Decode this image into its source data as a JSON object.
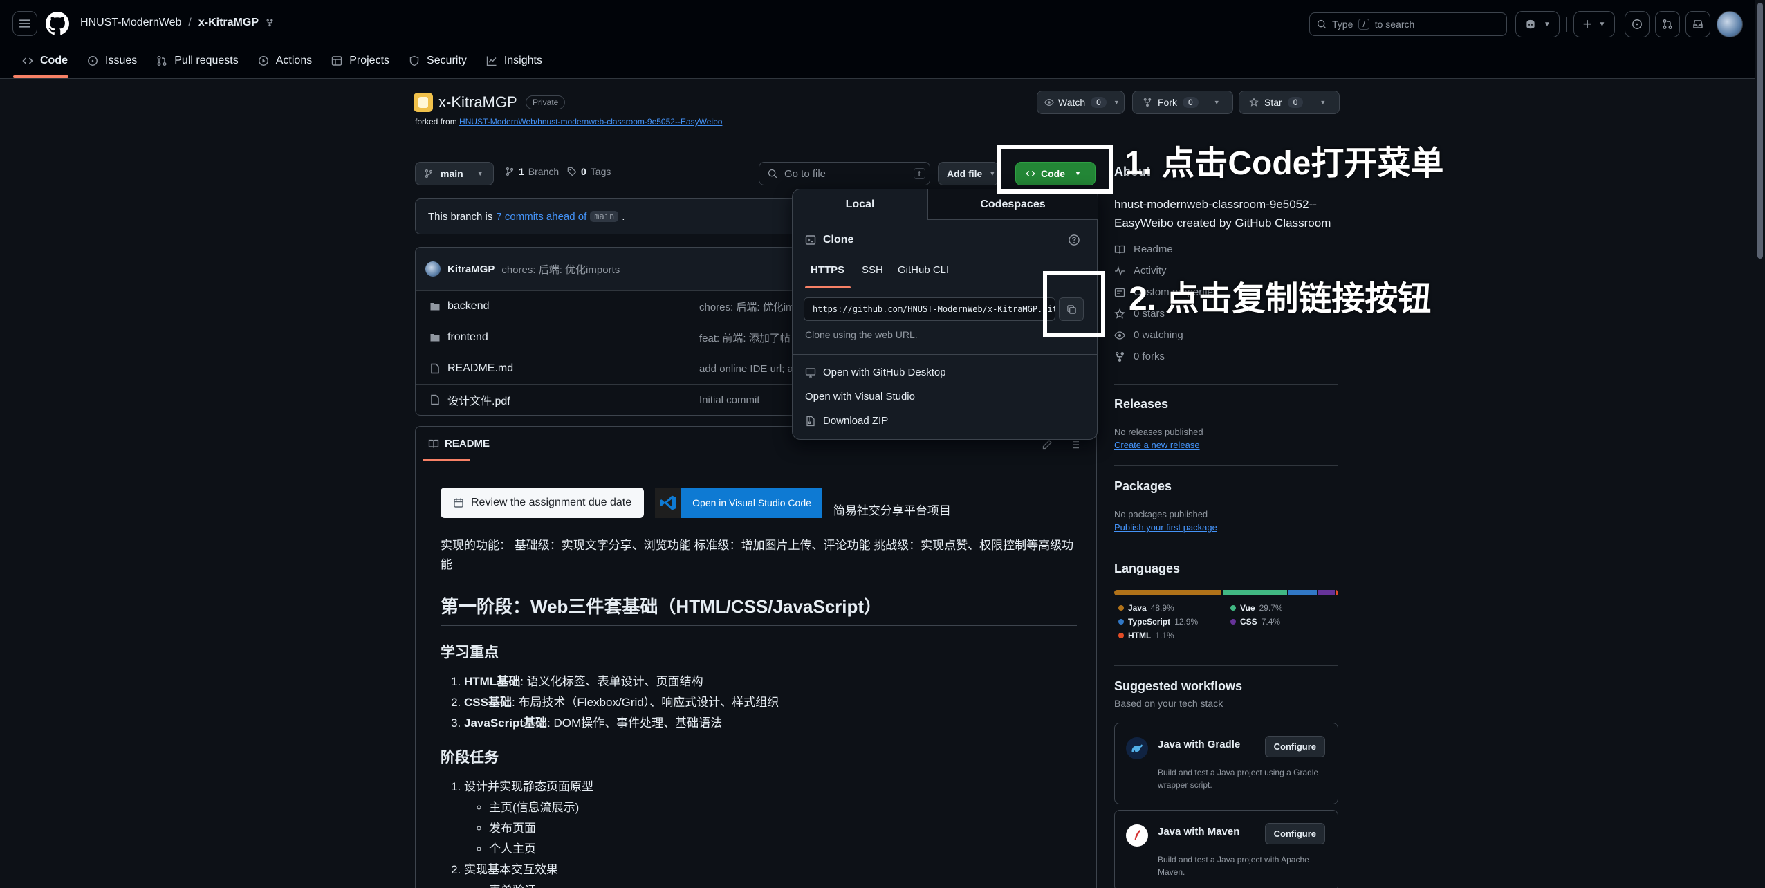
{
  "header": {
    "owner": "HNUST-ModernWeb",
    "separator": "/",
    "repo": "x-KitraMGP",
    "search_prefix": "Type",
    "search_key": "/",
    "search_suffix": "to search"
  },
  "tabs": [
    {
      "label": "Code",
      "icon": "code-icon"
    },
    {
      "label": "Issues",
      "icon": "issue-icon"
    },
    {
      "label": "Pull requests",
      "icon": "pull-request-icon"
    },
    {
      "label": "Actions",
      "icon": "play-icon"
    },
    {
      "label": "Projects",
      "icon": "table-icon"
    },
    {
      "label": "Security",
      "icon": "shield-icon"
    },
    {
      "label": "Insights",
      "icon": "graph-icon"
    }
  ],
  "repo": {
    "name": "x-KitraMGP",
    "visibility": "Private",
    "forked_prefix": "forked from",
    "forked_from": "HNUST-ModernWeb/hnust-modernweb-classroom-9e5052--EasyWeibo",
    "watch_label": "Watch",
    "watch_count": "0",
    "fork_label": "Fork",
    "fork_count": "0",
    "star_label": "Star",
    "star_count": "0"
  },
  "toolbar": {
    "branch": "main",
    "branch_count": "1",
    "branch_label": "Branch",
    "tag_count": "0",
    "tag_label": "Tags",
    "goto_placeholder": "Go to file",
    "goto_key": "t",
    "add_file": "Add file",
    "code": "Code"
  },
  "ahead": {
    "prefix": "This branch is",
    "link": "7 commits ahead of",
    "branch": "main",
    "suffix": "."
  },
  "commit": {
    "author": "KitraMGP",
    "message": "chores: 后端: 优化imports"
  },
  "files": [
    {
      "name": "backend",
      "type": "folder",
      "msg": "chores: 后端: 优化im"
    },
    {
      "name": "frontend",
      "type": "folder",
      "msg": "feat: 前端: 添加了帖"
    },
    {
      "name": "README.md",
      "type": "file",
      "msg": "add online IDE url; a"
    },
    {
      "name": "设计文件.pdf",
      "type": "file",
      "msg": "Initial commit"
    }
  ],
  "readme": {
    "title": "README",
    "due_button": "Review the assignment due date",
    "open_vscode": "Open in Visual Studio Code",
    "project_title": "简易社交分享平台项目",
    "intro": "实现的功能： 基础级：实现文字分享、浏览功能 标准级：增加图片上传、评论功能 挑战级：实现点赞、权限控制等高级功能",
    "h1": "第一阶段：Web三件套基础（HTML/CSS/JavaScript）",
    "h2_focus": "学习重点",
    "focus": [
      {
        "bold": "HTML基础",
        "rest": ": 语义化标签、表单设计、页面结构"
      },
      {
        "bold": "CSS基础",
        "rest": ": 布局技术（Flexbox/Grid）、响应式设计、样式组织"
      },
      {
        "bold": "JavaScript基础",
        "rest": ": DOM操作、事件处理、基础语法"
      }
    ],
    "h2_tasks": "阶段任务",
    "task1": "设计并实现静态页面原型",
    "task1_sub": [
      "主页(信息流展示)",
      "发布页面",
      "个人主页"
    ],
    "task2": "实现基本交互效果",
    "task2_sub": "表单验证"
  },
  "clone_menu": {
    "tab_local": "Local",
    "tab_codespaces": "Codespaces",
    "clone_title": "Clone",
    "proto_tabs": [
      "HTTPS",
      "SSH",
      "GitHub CLI"
    ],
    "url": "https://github.com/HNUST-ModernWeb/x-KitraMGP.git",
    "hint": "Clone using the web URL.",
    "desktop": "Open with GitHub Desktop",
    "vstudio": "Open with Visual Studio",
    "zip": "Download ZIP"
  },
  "about": {
    "title": "About",
    "description": "hnust-modernweb-classroom-9e5052--EasyWeibo created by GitHub Classroom",
    "readme": "Readme",
    "activity": "Activity",
    "custom": "Custom properties",
    "stars": "0 stars",
    "watching": "0 watching",
    "forks": "0 forks"
  },
  "releases": {
    "title": "Releases",
    "none": "No releases published",
    "link": "Create a new release"
  },
  "packages": {
    "title": "Packages",
    "none": "No packages published",
    "link": "Publish your first package"
  },
  "languages": {
    "title": "Languages",
    "items": [
      {
        "name": "Java",
        "pct": "48.9%",
        "value": 48.9,
        "color": "#b07219"
      },
      {
        "name": "Vue",
        "pct": "29.7%",
        "value": 29.7,
        "color": "#41b883"
      },
      {
        "name": "TypeScript",
        "pct": "12.9%",
        "value": 12.9,
        "color": "#3178c6"
      },
      {
        "name": "CSS",
        "pct": "7.4%",
        "value": 7.4,
        "color": "#663399"
      },
      {
        "name": "HTML",
        "pct": "1.1%",
        "value": 1.1,
        "color": "#e34c26"
      }
    ]
  },
  "workflows": {
    "title": "Suggested workflows",
    "subtitle": "Based on your tech stack",
    "items": [
      {
        "name": "Java with Gradle",
        "desc": "Build and test a Java project using a Gradle wrapper script.",
        "button": "Configure"
      },
      {
        "name": "Java with Maven",
        "desc": "Build and test a Java project with Apache Maven.",
        "button": "Configure"
      }
    ]
  },
  "annotations": {
    "step1": "1. 点击Code打开菜单",
    "step2": "2. 点击复制链接按钮"
  },
  "colors": {
    "green": "#238636",
    "accent": "#4493f8",
    "tab_underline": "#f78166"
  }
}
